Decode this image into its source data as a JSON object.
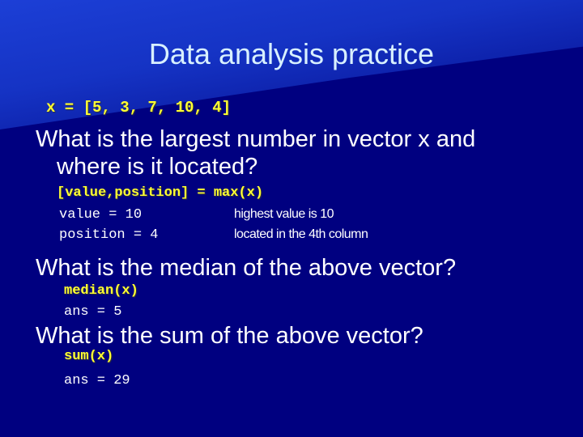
{
  "slide": {
    "title": "Data analysis practice",
    "vector_def": "x = [5, 3, 7, 10, 4]",
    "q1": {
      "line1": "What is the largest number in vector x and",
      "line2": "where is it located?",
      "code": "[value,position] = max(x)",
      "out1": "value = 10",
      "out2": "position = 4",
      "note1": "highest value is 10",
      "note2": "located in the 4th column"
    },
    "q2": {
      "question": "What is the median of the above vector?",
      "code": "median(x)",
      "out": "ans = 5"
    },
    "q3": {
      "question": "What is the sum of the above vector?",
      "code": "sum(x)",
      "out": "ans = 29"
    }
  }
}
